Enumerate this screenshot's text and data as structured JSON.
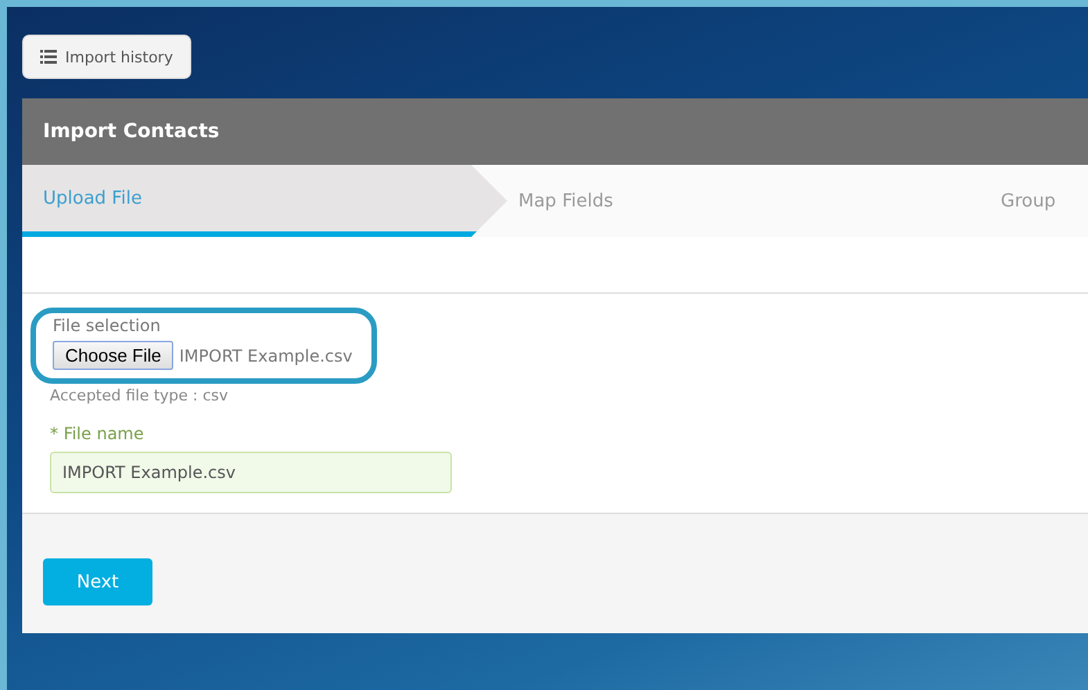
{
  "history_button": {
    "label": "Import history"
  },
  "panel": {
    "title": "Import Contacts"
  },
  "steps": [
    {
      "label": "Upload File",
      "selected": true
    },
    {
      "label": "Map Fields",
      "selected": false
    },
    {
      "label": "Group",
      "selected": false
    }
  ],
  "file_selection": {
    "label": "File selection",
    "button": "Choose File",
    "chosen_file": "IMPORT Example.csv",
    "hint": "Accepted file type : csv"
  },
  "file_name": {
    "label": "* File name",
    "value": "IMPORT Example.csv"
  },
  "buttons": [
    {
      "label": "Next"
    }
  ]
}
